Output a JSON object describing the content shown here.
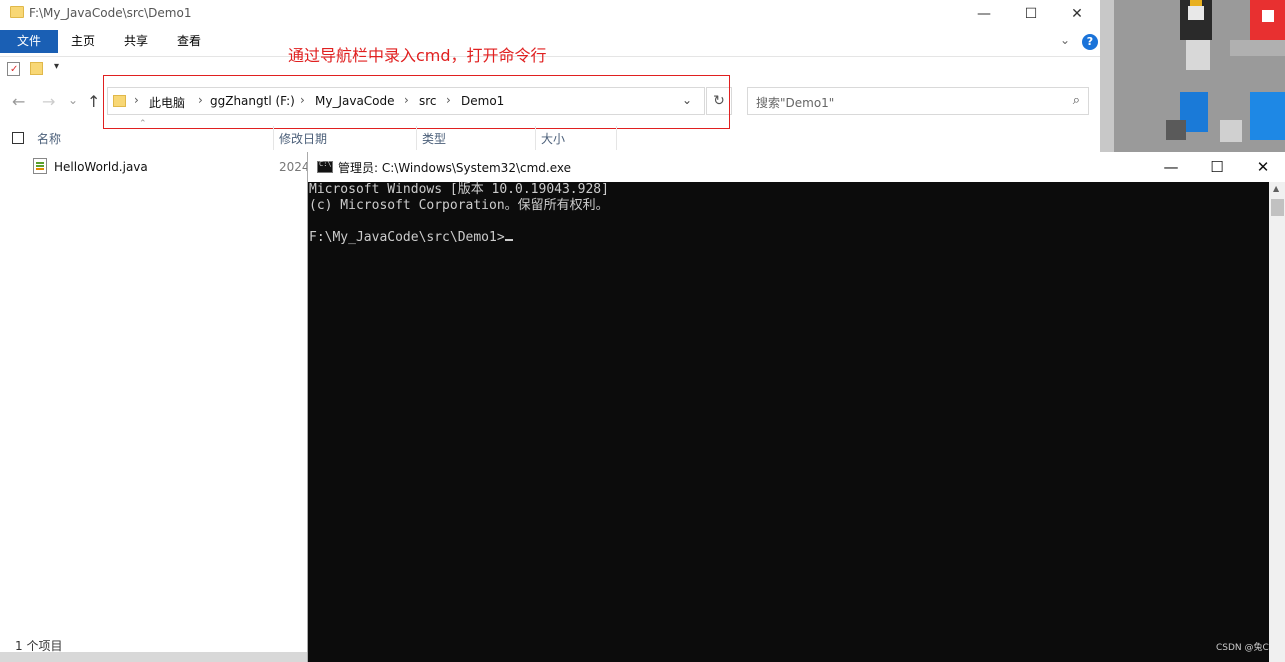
{
  "explorer": {
    "title": "F:\\My_JavaCode\\src\\Demo1",
    "window_controls": {
      "minimize": "—",
      "maximize": "☐",
      "close": "✕"
    },
    "ribbon_tabs": [
      "文件",
      "主页",
      "共享",
      "查看"
    ],
    "help": "?",
    "nav": {
      "back": "←",
      "forward": "→",
      "recent": "⌄",
      "up": "↑"
    },
    "breadcrumbs": [
      "此电脑",
      "ggZhangtl (F:)",
      "My_JavaCode",
      "src",
      "Demo1"
    ],
    "search_placeholder": "搜索\"Demo1\"",
    "columns": [
      "名称",
      "修改日期",
      "类型",
      "大小"
    ],
    "files": [
      {
        "name": "HelloWorld.java",
        "date": "2024"
      }
    ],
    "status": "1 个项目"
  },
  "annotation": {
    "text": "通过导航栏中录入cmd，打开命令行",
    "color": "#e02020"
  },
  "cmd": {
    "title": "管理员: C:\\Windows\\System32\\cmd.exe",
    "icon_label": "C:\\",
    "lines": [
      "Microsoft Windows [版本 10.0.19043.928]",
      "(c) Microsoft Corporation。保留所有权利。",
      "",
      "F:\\My_JavaCode\\src\\Demo1>"
    ],
    "window_controls": {
      "minimize": "—",
      "maximize": "☐",
      "close": "✕"
    }
  },
  "watermark": "CSDN @兔C",
  "colors": {
    "ribbon_file_tab": "#1a5fb4",
    "console_bg": "#0c0c0c",
    "console_fg": "#cccccc"
  }
}
